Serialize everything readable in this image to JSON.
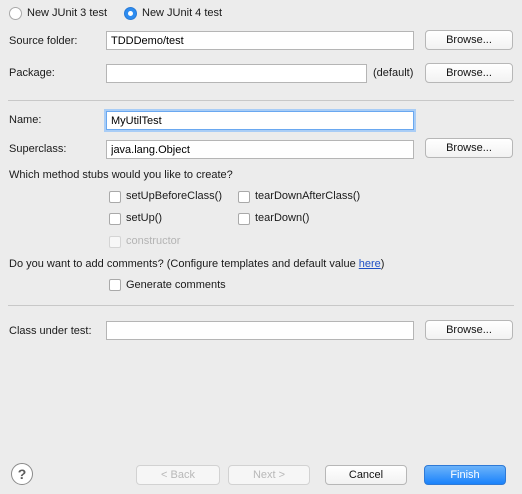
{
  "version_radios": [
    {
      "label": "New JUnit 3 test",
      "selected": false
    },
    {
      "label": "New JUnit 4 test",
      "selected": true
    }
  ],
  "source_folder": {
    "label": "Source folder:",
    "value": "TDDDemo/test",
    "browse_label": "Browse..."
  },
  "package": {
    "label": "Package:",
    "value": "",
    "default_text": "(default)",
    "browse_label": "Browse..."
  },
  "name": {
    "label": "Name:",
    "value": "MyUtilTest"
  },
  "superclass": {
    "label": "Superclass:",
    "value": "java.lang.Object",
    "browse_label": "Browse..."
  },
  "stubs": {
    "question": "Which method stubs would you like to create?",
    "items": [
      {
        "label": "setUpBeforeClass()",
        "checked": false,
        "enabled": true
      },
      {
        "label": "tearDownAfterClass()",
        "checked": false,
        "enabled": true
      },
      {
        "label": "setUp()",
        "checked": false,
        "enabled": true
      },
      {
        "label": "tearDown()",
        "checked": false,
        "enabled": true
      },
      {
        "label": "constructor",
        "checked": false,
        "enabled": false
      }
    ]
  },
  "comments": {
    "question_prefix": "Do you want to add comments? (Configure templates and default value ",
    "link_text": "here",
    "question_suffix": ")",
    "generate_label": "Generate comments",
    "checked": false
  },
  "class_under_test": {
    "label": "Class under test:",
    "value": "",
    "browse_label": "Browse..."
  },
  "footer": {
    "help_icon": "question-mark-icon",
    "help_glyph": "?",
    "back_label": "< Back",
    "next_label": "Next >",
    "cancel_label": "Cancel",
    "finish_label": "Finish"
  },
  "colors": {
    "accent": "#1a82fb",
    "link": "#1f50c6",
    "background": "#ececec"
  }
}
